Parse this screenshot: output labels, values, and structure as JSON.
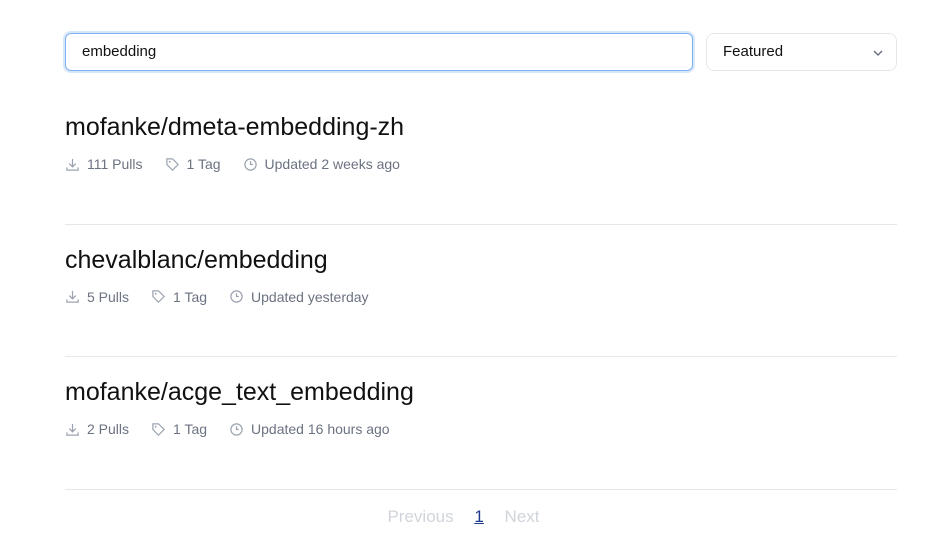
{
  "search": {
    "value": "embedding"
  },
  "sort": {
    "selected": "Featured"
  },
  "models": [
    {
      "name": "mofanke/dmeta-embedding-zh",
      "pulls": "111 Pulls",
      "tags": "1 Tag",
      "updated": "Updated 2 weeks ago"
    },
    {
      "name": "chevalblanc/embedding",
      "pulls": "5 Pulls",
      "tags": "1 Tag",
      "updated": "Updated yesterday"
    },
    {
      "name": "mofanke/acge_text_embedding",
      "pulls": "2 Pulls",
      "tags": "1 Tag",
      "updated": "Updated 16 hours ago"
    }
  ],
  "pagination": {
    "previous": "Previous",
    "current": "1",
    "next": "Next"
  }
}
